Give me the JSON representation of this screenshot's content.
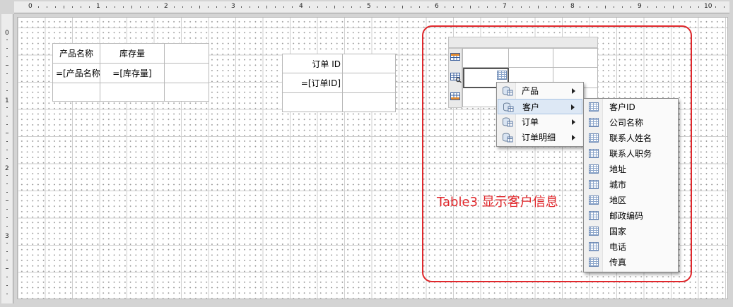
{
  "ruler": {
    "top_numbers": [
      "0",
      "1",
      "2",
      "3",
      "4",
      "5",
      "6",
      "7",
      "8",
      "9",
      "10"
    ],
    "left_numbers": [
      "0",
      "1",
      "2",
      "3"
    ]
  },
  "table1": {
    "header": [
      "产品名称",
      "库存量",
      ""
    ],
    "detail": [
      "=[产品名称]",
      "=[库存量]",
      ""
    ],
    "footer": [
      "",
      "",
      ""
    ]
  },
  "table2": {
    "header": [
      "订单 ID",
      ""
    ],
    "detail": [
      "=[订单ID]",
      ""
    ],
    "footer": [
      "",
      ""
    ]
  },
  "table3": {
    "row_handles": [
      "header-row-icon",
      "detail-row-icon",
      "footer-row-icon"
    ]
  },
  "context_menu": {
    "items": [
      {
        "label": "产品",
        "icon": "dataset-icon",
        "has_submenu": true,
        "selected": false
      },
      {
        "label": "客户",
        "icon": "dataset-icon",
        "has_submenu": true,
        "selected": true
      },
      {
        "label": "订单",
        "icon": "dataset-icon",
        "has_submenu": true,
        "selected": false
      },
      {
        "label": "订单明细",
        "icon": "dataset-icon",
        "has_submenu": true,
        "selected": false
      }
    ]
  },
  "submenu": {
    "items": [
      {
        "label": "客户ID",
        "icon": "field-icon"
      },
      {
        "label": "公司名称",
        "icon": "field-icon"
      },
      {
        "label": "联系人姓名",
        "icon": "field-icon"
      },
      {
        "label": "联系人职务",
        "icon": "field-icon"
      },
      {
        "label": "地址",
        "icon": "field-icon"
      },
      {
        "label": "城市",
        "icon": "field-icon"
      },
      {
        "label": "地区",
        "icon": "field-icon"
      },
      {
        "label": "邮政编码",
        "icon": "field-icon"
      },
      {
        "label": "国家",
        "icon": "field-icon"
      },
      {
        "label": "电话",
        "icon": "field-icon"
      },
      {
        "label": "传真",
        "icon": "field-icon"
      }
    ]
  },
  "annotation": {
    "text": "Table3 显示客户信息",
    "color": "#e0282c"
  },
  "colors": {
    "selection_highlight": "#dde8f5",
    "active_cell_border": "#555555"
  }
}
